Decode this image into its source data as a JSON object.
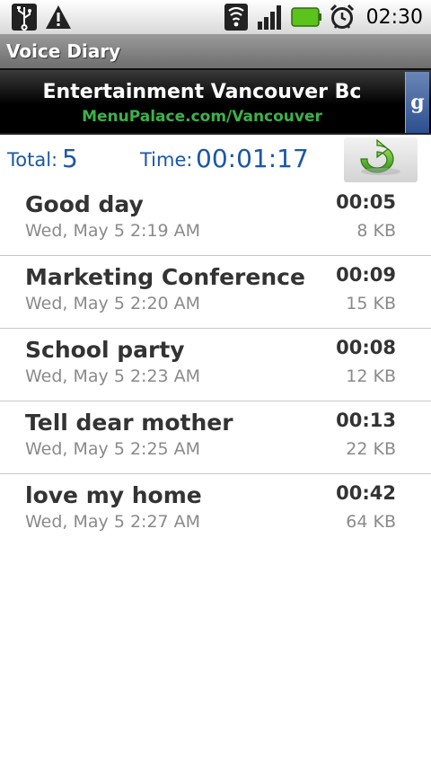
{
  "status_bar": {
    "time": "02:30",
    "icons": [
      "usb-icon",
      "warning-icon",
      "wifi-icon",
      "signal-icon",
      "battery-icon",
      "alarm-icon"
    ]
  },
  "app": {
    "title": "Voice Diary"
  },
  "ad": {
    "title": "Entertainment Vancouver Bc",
    "url": "MenuPalace.com/Vancouver",
    "side_letter": "g",
    "url_color": "#3cb24a"
  },
  "summary": {
    "total_label": "Total:",
    "total_value": "5",
    "time_label": "Time:",
    "time_value": "00:01:17",
    "accent_color": "#1a57a8",
    "refresh_icon": "refresh-icon"
  },
  "recordings": [
    {
      "title": "Good day",
      "date": "Wed, May 5 2:19 AM",
      "duration": "00:05",
      "size": "8 KB"
    },
    {
      "title": "Marketing Conference",
      "date": "Wed, May 5 2:20 AM",
      "duration": "00:09",
      "size": "15 KB"
    },
    {
      "title": "School party",
      "date": "Wed, May 5 2:23 AM",
      "duration": "00:08",
      "size": "12 KB"
    },
    {
      "title": "Tell dear mother",
      "date": "Wed, May 5 2:25 AM",
      "duration": "00:13",
      "size": "22 KB"
    },
    {
      "title": "love my home",
      "date": "Wed, May 5 2:27 AM",
      "duration": "00:42",
      "size": "64 KB"
    }
  ]
}
